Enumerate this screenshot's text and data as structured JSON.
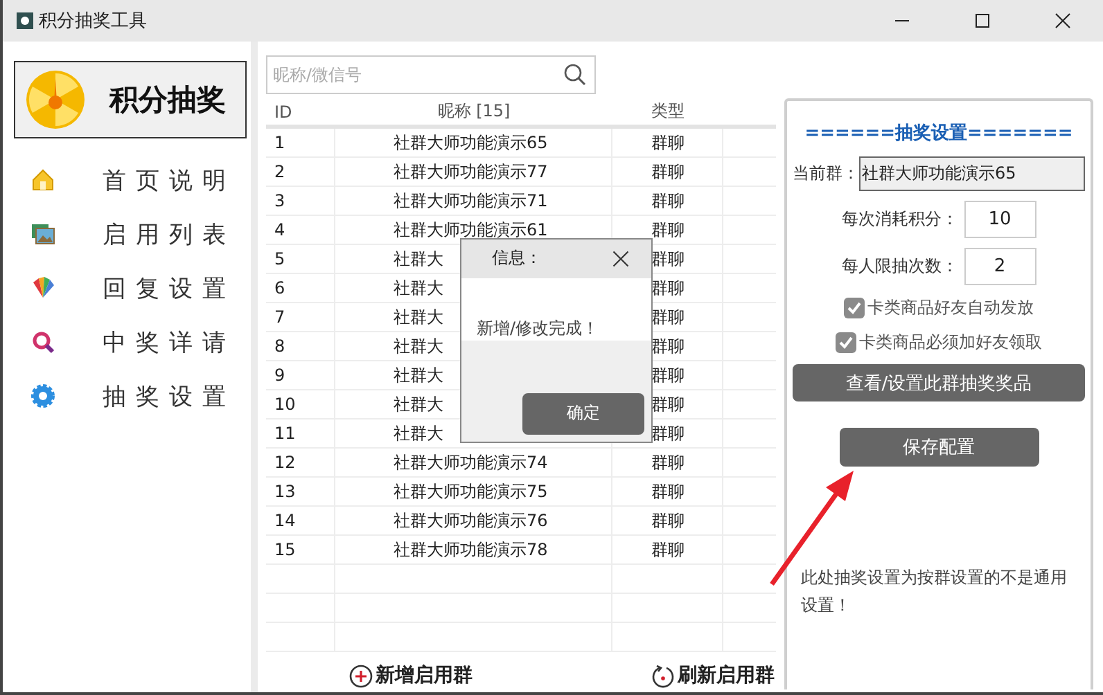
{
  "window": {
    "title": "积分抽奖工具"
  },
  "sidebar": {
    "header": "积分抽奖",
    "items": [
      {
        "label": "首页说明",
        "kind": "home"
      },
      {
        "label": "启用列表",
        "kind": "gallery"
      },
      {
        "label": "回复设置",
        "kind": "cards"
      },
      {
        "label": "中奖详请",
        "kind": "search"
      },
      {
        "label": "抽奖设置",
        "kind": "gear"
      }
    ]
  },
  "search": {
    "placeholder": "昵称/微信号"
  },
  "table": {
    "columns": [
      "ID",
      "昵称 [15]",
      "类型"
    ],
    "rows": [
      {
        "id": "1",
        "name": "社群大师功能演示65",
        "type": "群聊"
      },
      {
        "id": "2",
        "name": "社群大师功能演示77",
        "type": "群聊"
      },
      {
        "id": "3",
        "name": "社群大师功能演示71",
        "type": "群聊"
      },
      {
        "id": "4",
        "name": "社群大师功能演示61",
        "type": "群聊"
      },
      {
        "id": "5",
        "name": "社群大",
        "type": "群聊"
      },
      {
        "id": "6",
        "name": "社群大",
        "type": "群聊"
      },
      {
        "id": "7",
        "name": "社群大",
        "type": "群聊"
      },
      {
        "id": "8",
        "name": "社群大",
        "type": "群聊"
      },
      {
        "id": "9",
        "name": "社群大",
        "type": "群聊"
      },
      {
        "id": "10",
        "name": "社群大",
        "type": "群聊"
      },
      {
        "id": "11",
        "name": "社群大",
        "type": "群聊"
      },
      {
        "id": "12",
        "name": "社群大师功能演示74",
        "type": "群聊"
      },
      {
        "id": "13",
        "name": "社群大师功能演示75",
        "type": "群聊"
      },
      {
        "id": "14",
        "name": "社群大师功能演示76",
        "type": "群聊"
      },
      {
        "id": "15",
        "name": "社群大师功能演示78",
        "type": "群聊"
      }
    ]
  },
  "actions": [
    {
      "label": "新增启用群",
      "kind": "add"
    },
    {
      "label": "刷新启用群",
      "kind": "refresh"
    }
  ],
  "settings": {
    "title": "======抽奖设置=======",
    "current_group": {
      "label": "当前群：",
      "value": "社群大师功能演示65"
    },
    "fields": [
      {
        "label": "每次消耗积分：",
        "value": "10"
      },
      {
        "label": "每人限抽次数：",
        "value": "2"
      }
    ],
    "checkboxes": [
      {
        "label": "卡类商品好友自动发放",
        "checked": true
      },
      {
        "label": "卡类商品必须加好友领取",
        "checked": true
      }
    ],
    "prizes_button": "查看/设置此群抽奖奖品",
    "save_button": "保存配置",
    "note": "此处抽奖设置为按群设置的不是通用设置！"
  },
  "dialog": {
    "title": "信息：",
    "message": "新增/修改完成！",
    "button": "确定"
  }
}
